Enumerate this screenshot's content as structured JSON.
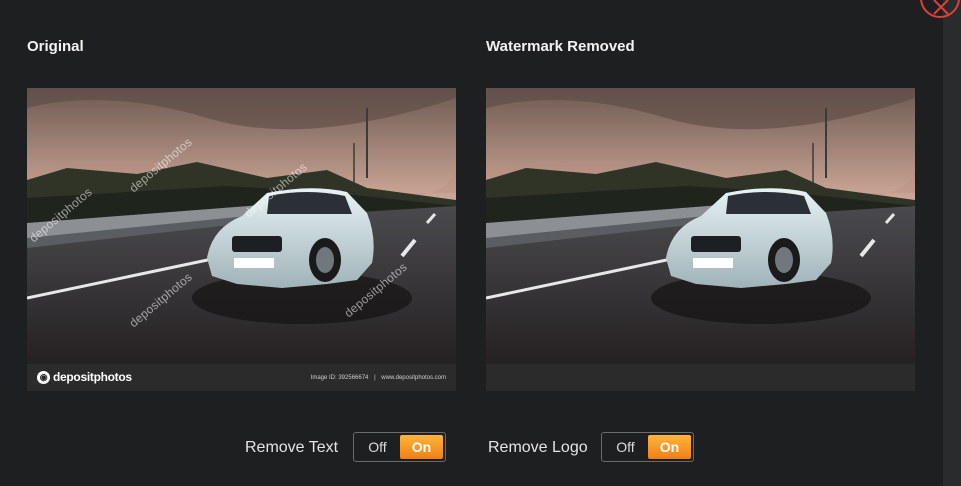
{
  "panels": {
    "left_title": "Original",
    "right_title": "Watermark Removed"
  },
  "watermark": {
    "brand": "depositphotos",
    "image_id": "Image ID: 392566674",
    "site": "www.depositphotos.com"
  },
  "controls": {
    "remove_text_label": "Remove Text",
    "remove_logo_label": "Remove Logo",
    "off_label": "Off",
    "on_label": "On",
    "remove_text_state": "On",
    "remove_logo_state": "On"
  },
  "colors": {
    "accent_on": "#f59a22",
    "close": "#e0403a",
    "background": "#1e1f21"
  }
}
